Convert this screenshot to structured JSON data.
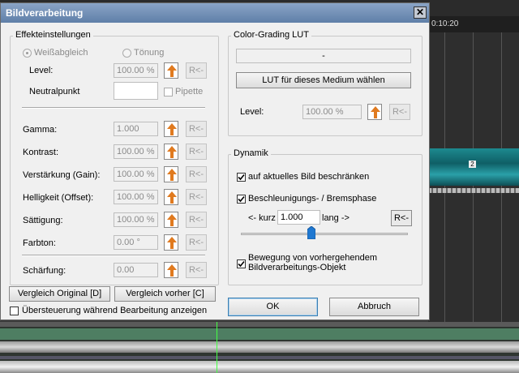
{
  "background": {
    "timecode": "0:10:20",
    "clip_marker": "2"
  },
  "dialog": {
    "title": "Bildverarbeitung",
    "close_glyph": "✕",
    "effects": {
      "group_label": "Effekteinstellungen",
      "white_balance_label": "Weißabgleich",
      "tint_label": "Tönung",
      "level_label": "Level:",
      "level_value": "100.00 %",
      "neutral_point_label": "Neutralpunkt",
      "pipette_label": "Pipette",
      "rows": [
        {
          "label": "Gamma:",
          "value": "1.000",
          "reset": "R<-"
        },
        {
          "label": "Kontrast:",
          "value": "100.00 %",
          "reset": "R<-"
        },
        {
          "label": "Verstärkung (Gain):",
          "value": "100.00 %",
          "reset": "R<-"
        },
        {
          "label": "Helligkeit (Offset):",
          "value": "100.00 %",
          "reset": "R<-"
        },
        {
          "label": "Sättigung:",
          "value": "100.00 %",
          "reset": "R<-"
        },
        {
          "label": "Farbton:",
          "value": "0.00 °",
          "reset": "R<-"
        }
      ],
      "sharpen_label": "Schärfung:",
      "sharpen_value": "0.00",
      "reset_label": "R<-"
    },
    "lut": {
      "group_label": "Color-Grading LUT",
      "current_value": "-",
      "choose_button": "LUT für dieses Medium wählen",
      "level_label": "Level:",
      "level_value": "100.00 %",
      "reset_label": "R<-"
    },
    "dynamics": {
      "group_label": "Dynamik",
      "limit_current_label": "auf aktuelles Bild beschränken",
      "limit_current_checked": true,
      "accel_label": "Beschleunigungs- / Bremsphase",
      "accel_checked": true,
      "short_label": "<- kurz",
      "accel_value": "1.000",
      "long_label": "lang ->",
      "reset_label": "R<-",
      "slider_level": 0.42,
      "follow_line1": "Bewegung von vorhergehendem",
      "follow_line2": "Bildverarbeitungs-Objekt",
      "follow_checked": true
    },
    "buttons": {
      "compare_original": "Vergleich Original [D]",
      "compare_previous": "Vergleich vorher [C]",
      "overload_label": "Übersteuerung während Bearbeitung anzeigen",
      "overload_checked": false,
      "ok": "OK",
      "cancel": "Abbruch"
    }
  }
}
